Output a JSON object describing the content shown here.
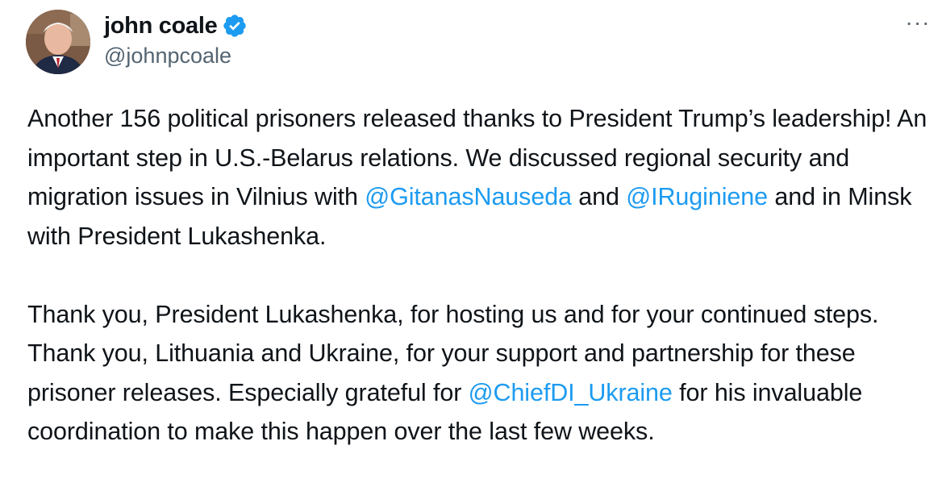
{
  "author": {
    "display_name": "john coale",
    "handle": "@johnpcoale",
    "verified": true
  },
  "more_menu_icon": "more-horizontal-icon",
  "colors": {
    "mention": "#1d9bf0",
    "verified_badge": "#1d9bf0",
    "secondary_text": "#536471"
  },
  "tweet": {
    "p1": {
      "t1": "Another 156 political prisoners released thanks to President Trump’s leadership! An important step in U.S.-Belarus relations. We discussed regional security and migration issues in Vilnius with ",
      "m1": "@GitanasNauseda",
      "t2": " and ",
      "m2": "@IRuginiene",
      "t3": " and in Minsk with President Lukashenka."
    },
    "p2": {
      "t1": "Thank you, President Lukashenka, for hosting us and for your continued steps. Thank you, Lithuania and Ukraine, for your support and partnership for these prisoner releases. Especially grateful for ",
      "m1": "@ChiefDI_Ukraine",
      "t2": " for his invaluable coordination to make this happen over the last few weeks."
    }
  }
}
